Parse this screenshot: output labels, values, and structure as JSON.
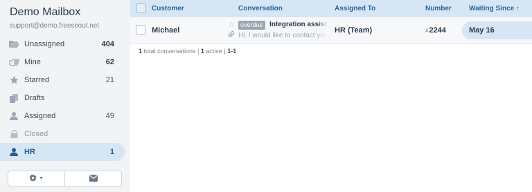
{
  "mailbox": {
    "name": "Demo Mailbox",
    "email": "support@demo.freescout.net"
  },
  "folders": [
    {
      "label": "Unassigned",
      "count": "404",
      "icon": "folder-open-icon"
    },
    {
      "label": "Mine",
      "count": "62",
      "icon": "hand-pointing-icon"
    },
    {
      "label": "Starred",
      "count": "21",
      "icon": "star-icon"
    },
    {
      "label": "Drafts",
      "count": "",
      "icon": "drafts-icon"
    },
    {
      "label": "Assigned",
      "count": "49",
      "icon": "user-icon"
    },
    {
      "label": "Closed",
      "count": "",
      "icon": "lock-icon"
    },
    {
      "label": "HR",
      "count": "1",
      "icon": "user-icon"
    }
  ],
  "sidebar_actions": {
    "settings_icon": "gear-icon",
    "compose_icon": "envelope-icon"
  },
  "table": {
    "columns": {
      "customer": "Customer",
      "conversation": "Conversation",
      "assigned_to": "Assigned To",
      "number": "Number",
      "waiting_since": "Waiting Since ↑"
    },
    "rows": [
      {
        "customer": "Michael",
        "badge": "overdue",
        "subject": "Integration assistance",
        "preview": "Hi. I would like to contact you",
        "assigned_to": "HR (Team)",
        "number_prefix": "#",
        "number": "2244",
        "waiting_since": "May 16"
      }
    ]
  },
  "footer": {
    "total": "1",
    "total_label": " total conversations | ",
    "active": "1",
    "active_label": " active | ",
    "range": "1-1"
  },
  "colors": {
    "accent": "#2a6496",
    "header_bg": "#d6e6f5",
    "sidebar_bg": "#f1f3f5"
  }
}
